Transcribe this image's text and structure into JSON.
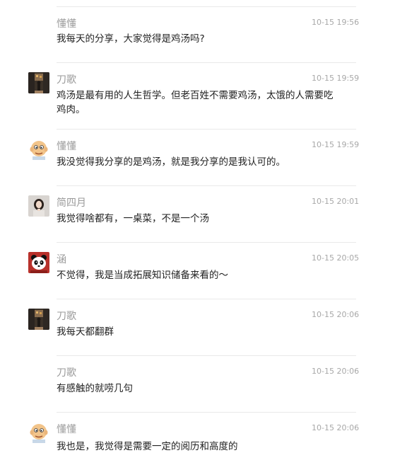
{
  "messages": [
    {
      "sender": "懂懂",
      "time": "10-15 19:56",
      "text": "我每天的分享，大家觉得是鸡汤吗?",
      "avatar": "none"
    },
    {
      "sender": "刀歌",
      "time": "10-15 19:59",
      "text": "鸡汤是最有用的人生哲学。但老百姓不需要鸡汤，太饿的人需要吃鸡肉。",
      "avatar": "photo-street-night"
    },
    {
      "sender": "懂懂",
      "time": "10-15 19:59",
      "text": "我没觉得我分享的是鸡汤，就是我分享的是我认可的。",
      "avatar": "cartoon-bald-man"
    },
    {
      "sender": "简四月",
      "time": "10-15 20:01",
      "text": "我觉得啥都有，一桌菜，不是一个汤",
      "avatar": "photo-woman"
    },
    {
      "sender": "涵",
      "time": "10-15 20:05",
      "text": "不觉得，我是当成拓展知识储备来看的～",
      "avatar": "cartoon-panda-red"
    },
    {
      "sender": "刀歌",
      "time": "10-15 20:06",
      "text": "我每天都翻群",
      "avatar": "photo-street-night"
    },
    {
      "sender": "刀歌",
      "time": "10-15 20:06",
      "text": "有感触的就唠几句",
      "avatar": "none"
    },
    {
      "sender": "懂懂",
      "time": "10-15 20:06",
      "text": "我也是，我觉得是需要一定的阅历和高度的",
      "avatar": "cartoon-bald-man"
    }
  ]
}
